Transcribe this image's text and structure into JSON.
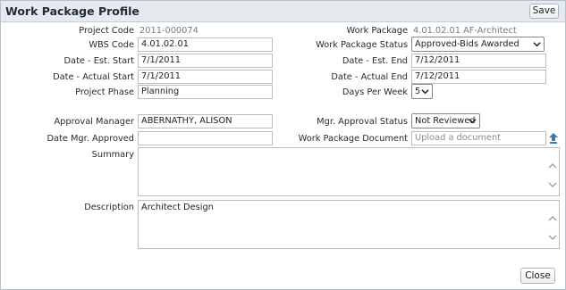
{
  "window": {
    "title": "Work Package Profile"
  },
  "toolbar": {
    "save_label": "Save",
    "close_label": "Close"
  },
  "fields": {
    "project_code": {
      "label": "Project Code",
      "value": "2011-000074"
    },
    "work_package": {
      "label": "Work Package",
      "value": "4.01.02.01 AF-Architect"
    },
    "wbs_code": {
      "label": "WBS Code",
      "value": "4.01.02.01"
    },
    "wp_status": {
      "label": "Work Package Status",
      "value": "Approved-Bids Awarded"
    },
    "est_start": {
      "label": "Date - Est. Start",
      "value": "7/1/2011"
    },
    "est_end": {
      "label": "Date - Est. End",
      "value": "7/12/2011"
    },
    "actual_start": {
      "label": "Date - Actual Start",
      "value": "7/1/2011"
    },
    "actual_end": {
      "label": "Date - Actual End",
      "value": "7/12/2011"
    },
    "project_phase": {
      "label": "Project Phase",
      "value": "Planning"
    },
    "days_per_week": {
      "label": "Days Per Week",
      "value": "5"
    },
    "approval_manager": {
      "label": "Approval Manager",
      "value": "ABERNATHY, ALISON"
    },
    "mgr_approval_status": {
      "label": "Mgr. Approval Status",
      "value": "Not Reviewed"
    },
    "date_mgr_approved": {
      "label": "Date Mgr. Approved",
      "value": ""
    },
    "wp_document": {
      "label": "Work Package Document",
      "placeholder": "Upload a document"
    },
    "summary": {
      "label": "Summary",
      "value": ""
    },
    "description": {
      "label": "Description",
      "value": "Architect Design"
    }
  },
  "icons": {
    "upload": "upload-arrow-icon",
    "dropdown": "chevron-down-icon",
    "scroll_up": "scroll-up-icon",
    "scroll_down": "scroll-down-icon"
  },
  "colors": {
    "titlebar_bg": "#e6eaee",
    "upload_icon": "#3d78b5"
  }
}
